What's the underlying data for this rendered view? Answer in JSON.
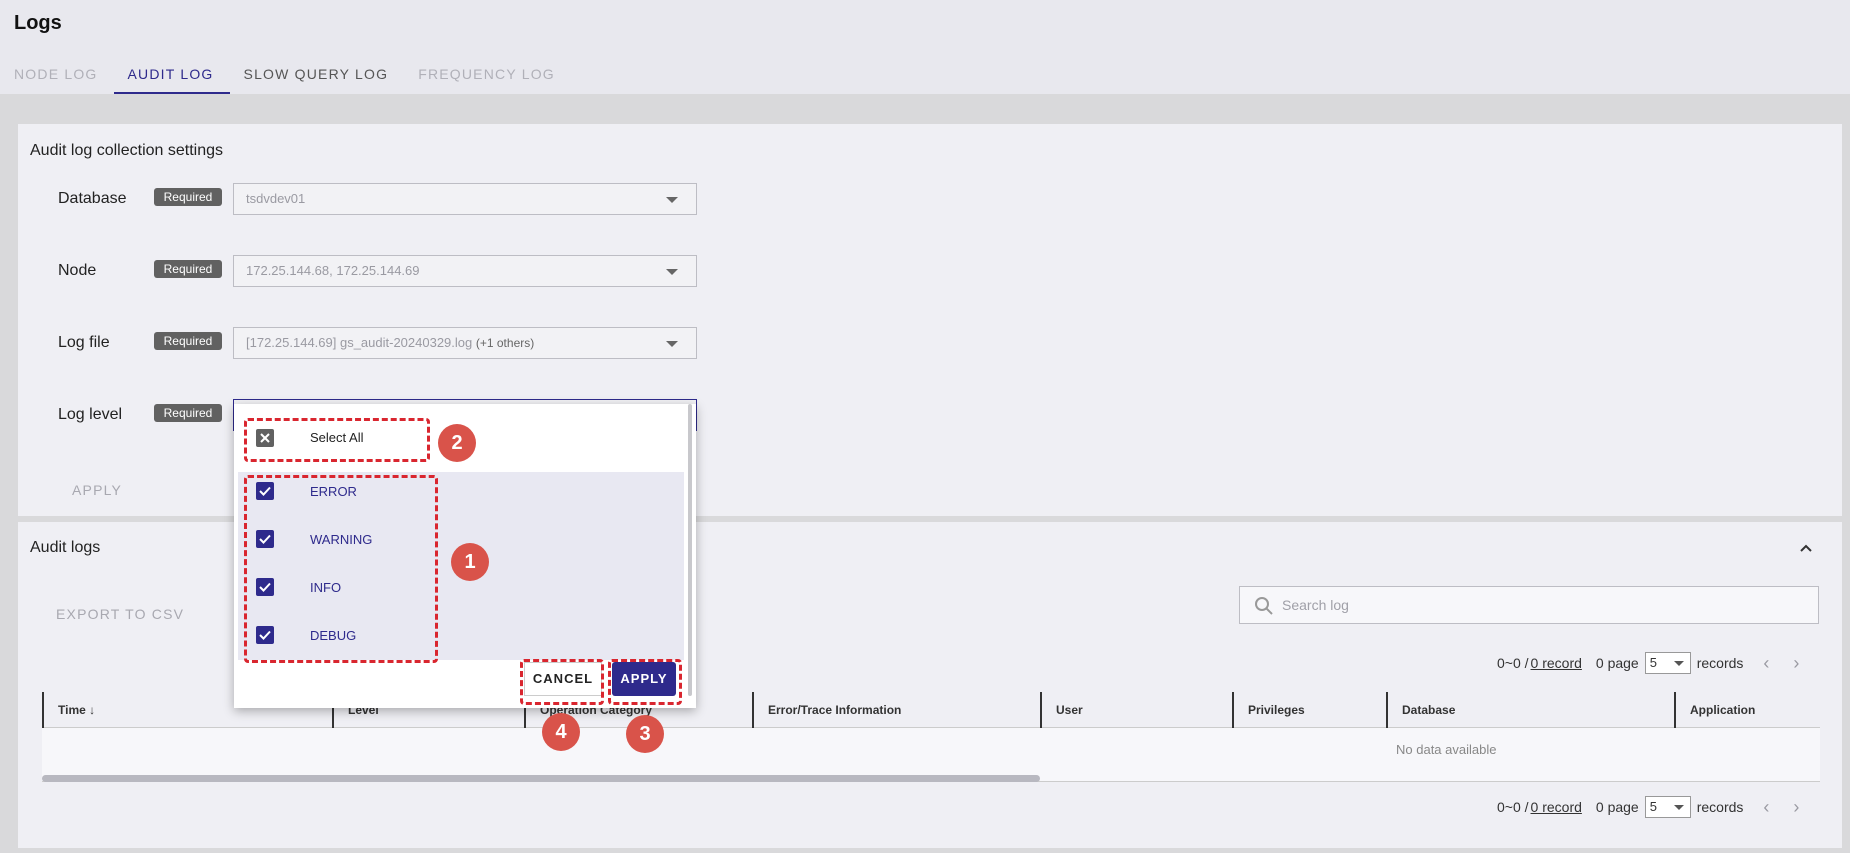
{
  "header": {
    "title": "Logs",
    "tabs": [
      {
        "label": "NODE LOG"
      },
      {
        "label": "AUDIT LOG"
      },
      {
        "label": "SLOW QUERY LOG"
      },
      {
        "label": "FREQUENCY LOG"
      }
    ]
  },
  "settings": {
    "title": "Audit log collection settings",
    "required_label": "Required",
    "fields": [
      {
        "label": "Database",
        "value": "tsdvdev01"
      },
      {
        "label": "Node",
        "value": "172.25.144.68, 172.25.144.69"
      },
      {
        "label": "Log file",
        "value": "[172.25.144.69] gs_audit-20240329.log",
        "extra": "(+1 others)"
      },
      {
        "label": "Log level",
        "value": ""
      }
    ],
    "apply_label": "APPLY"
  },
  "dropdown": {
    "select_all_label": "Select All",
    "options": [
      {
        "label": "ERROR",
        "checked": true
      },
      {
        "label": "WARNING",
        "checked": true
      },
      {
        "label": "INFO",
        "checked": true
      },
      {
        "label": "DEBUG",
        "checked": true
      }
    ],
    "cancel_label": "CANCEL",
    "apply_label": "APPLY"
  },
  "audit_logs": {
    "title": "Audit logs",
    "export_label": "EXPORT TO CSV",
    "search_placeholder": "Search log",
    "pager": {
      "range": "0~0 /",
      "records_link": "0 record",
      "pages": "0 page",
      "page_size": "5",
      "records_label": "records"
    },
    "columns": [
      "Time",
      "Level",
      "Operation Category",
      "Error/Trace Information",
      "User",
      "Privileges",
      "Database",
      "Application"
    ],
    "empty_text": "No data available"
  },
  "annotations": [
    "1",
    "2",
    "3",
    "4"
  ],
  "colors": {
    "accent": "#2e2a8c",
    "annotation": "#d9262f"
  }
}
